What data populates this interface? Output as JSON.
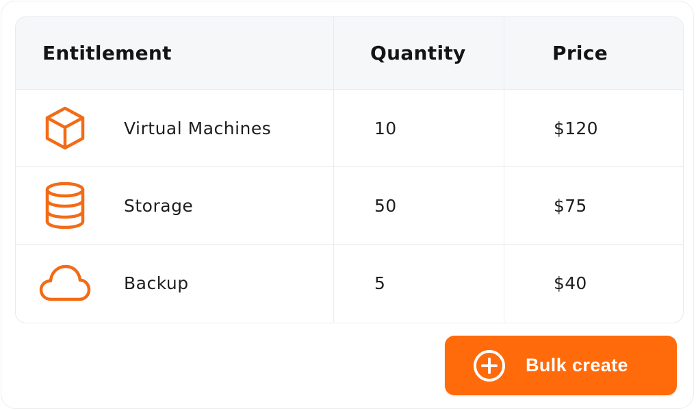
{
  "table": {
    "headers": {
      "entitlement": "Entitlement",
      "quantity": "Quantity",
      "price": "Price"
    },
    "rows": [
      {
        "icon": "cube-icon",
        "name": "Virtual Machines",
        "quantity": "10",
        "price": "$120"
      },
      {
        "icon": "database-icon",
        "name": "Storage",
        "quantity": "50",
        "price": "$75"
      },
      {
        "icon": "cloud-icon",
        "name": "Backup",
        "quantity": "5",
        "price": "$40"
      }
    ]
  },
  "actions": {
    "bulk_create_label": "Bulk create",
    "bulk_create_icon": "plus-circle-icon"
  },
  "colors": {
    "accent": "#ff6a0a",
    "header_bg": "#f6f7f9",
    "border": "#e8eaee"
  }
}
